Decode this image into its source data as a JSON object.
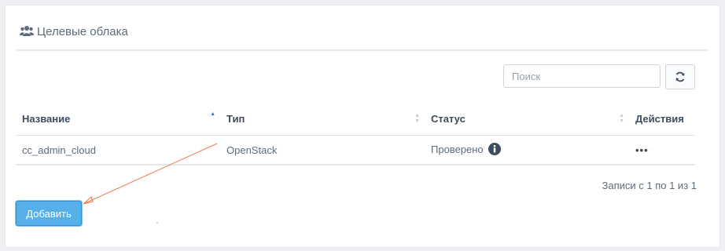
{
  "panel": {
    "title": "Целевые облака",
    "title_icon": "users-icon"
  },
  "search": {
    "placeholder": "Поиск",
    "value": ""
  },
  "refresh": {
    "icon": "refresh-icon"
  },
  "table": {
    "columns": [
      {
        "label": "Название",
        "sort": "asc"
      },
      {
        "label": "Тип",
        "sort": "none"
      },
      {
        "label": "Статус",
        "sort": "none"
      },
      {
        "label": "Действия"
      }
    ],
    "rows": [
      {
        "name": "cc_admin_cloud",
        "type": "OpenStack",
        "status": "Проверено",
        "status_icon": "info-icon",
        "actions": "•••"
      }
    ]
  },
  "records_info": "Записи с 1 по 1 из 1",
  "add_button": {
    "label": "Добавить"
  },
  "colors": {
    "accent": "#55b0ea",
    "annotation": "#f07a4a",
    "text": "#5d6b7c"
  }
}
